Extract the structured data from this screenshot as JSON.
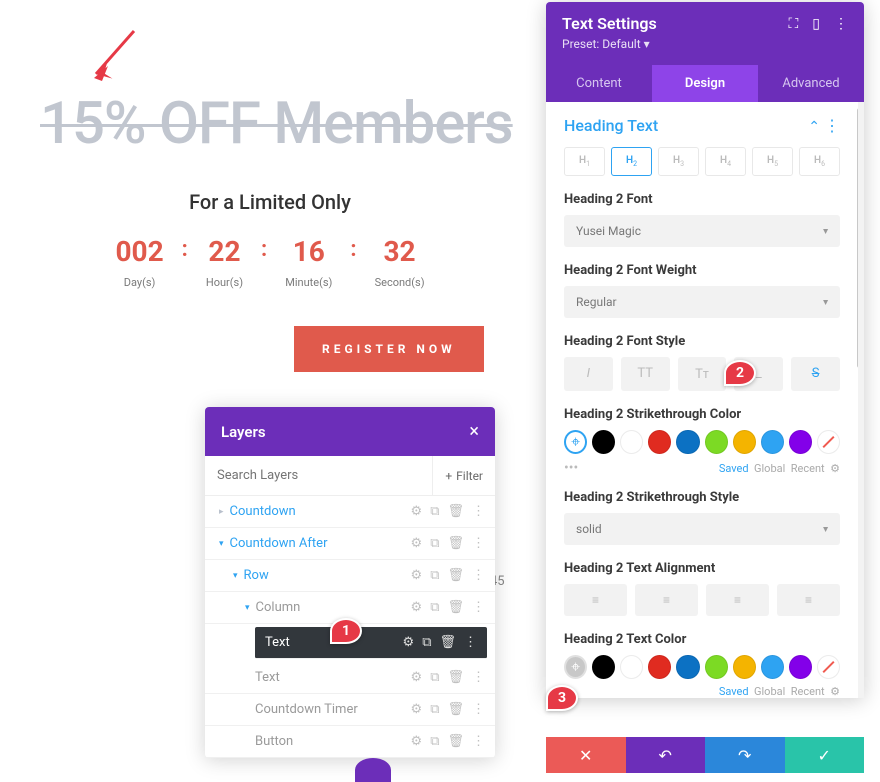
{
  "main": {
    "headline": "15% OFF Members",
    "subhead": "For a Limited Only",
    "countdown": [
      {
        "value": "002",
        "label": "Day(s)"
      },
      {
        "value": "22",
        "label": "Hour(s)"
      },
      {
        "value": "16",
        "label": "Minute(s)"
      },
      {
        "value": "32",
        "label": "Second(s)"
      }
    ],
    "register_label": "REGISTER NOW",
    "stray_number": "45"
  },
  "layers": {
    "title": "Layers",
    "search_placeholder": "Search Layers",
    "filter_label": "Filter",
    "items": [
      {
        "name": "Countdown",
        "level": 1,
        "expanded": false
      },
      {
        "name": "Countdown After",
        "level": 1,
        "expanded": true
      },
      {
        "name": "Row",
        "level": 2,
        "expanded": true
      },
      {
        "name": "Column",
        "level": 3,
        "expanded": true
      },
      {
        "name": "Text",
        "level": 4,
        "active": true
      },
      {
        "name": "Text",
        "level": 4
      },
      {
        "name": "Countdown Timer",
        "level": 4
      },
      {
        "name": "Button",
        "level": 4
      }
    ]
  },
  "settings": {
    "title": "Text Settings",
    "preset": "Preset: Default",
    "tabs": [
      "Content",
      "Design",
      "Advanced"
    ],
    "active_tab": 1,
    "section_title": "Heading Text",
    "heading_levels": [
      "H1",
      "H2",
      "H3",
      "H4",
      "H5",
      "H6"
    ],
    "active_heading": 1,
    "font_label": "Heading 2 Font",
    "font_value": "Yusei Magic",
    "weight_label": "Heading 2 Font Weight",
    "weight_value": "Regular",
    "style_label": "Heading 2 Font Style",
    "style_options": [
      "I",
      "TT",
      "Tᴛ",
      "_",
      "S"
    ],
    "strike_color_label": "Heading 2 Strikethrough Color",
    "swatch_footer": {
      "saved": "Saved",
      "global": "Global",
      "recent": "Recent"
    },
    "strike_style_label": "Heading 2 Strikethrough Style",
    "strike_style_value": "solid",
    "align_label": "Heading 2 Text Alignment",
    "text_color_label": "Heading 2 Text Color",
    "colors": [
      "#000000",
      "#ffffff",
      "#e02b20",
      "#0c71c3",
      "#7cda24",
      "#f4b400",
      "#2ea3f2",
      "#8300e9"
    ]
  },
  "annotations": {
    "a1": "1",
    "a2": "2",
    "a3": "3"
  }
}
